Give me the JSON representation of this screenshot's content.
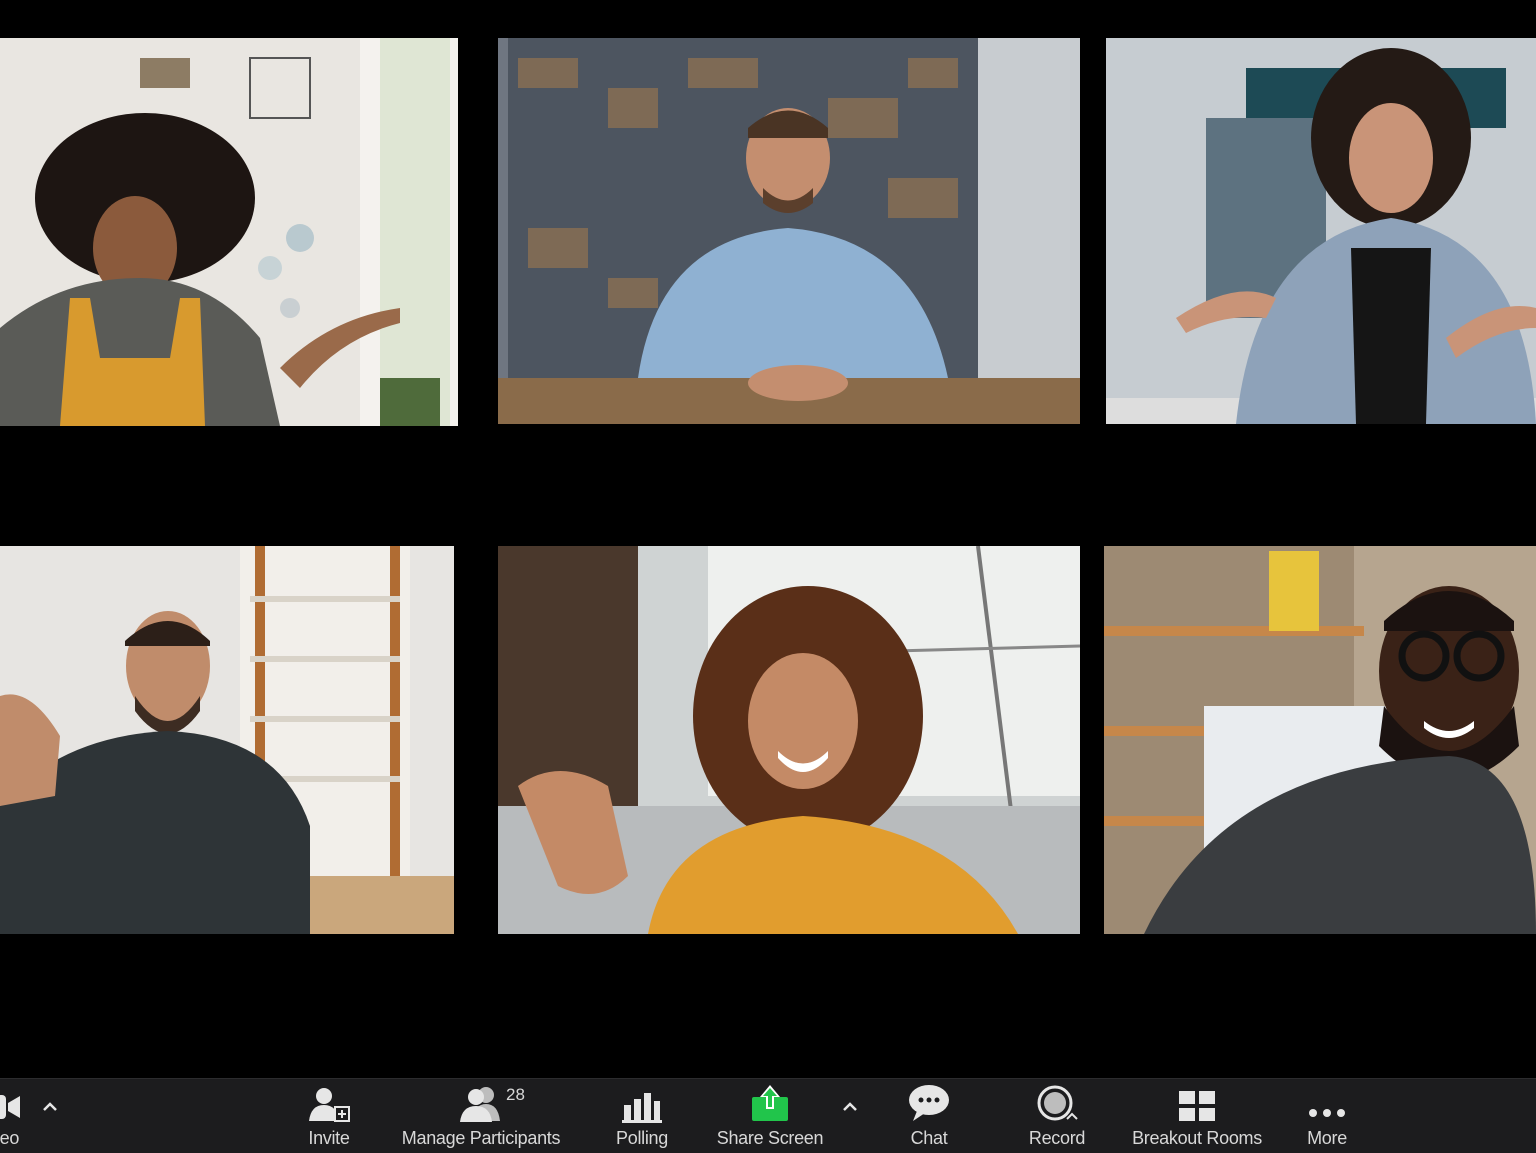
{
  "toolbar": {
    "video_label": "Video",
    "invite_label": "Invite",
    "participants_label": "Manage Participants",
    "participants_count": "28",
    "polling_label": "Polling",
    "share_label": "Share Screen",
    "chat_label": "Chat",
    "record_label": "Record",
    "breakout_label": "Breakout Rooms",
    "more_label": "More"
  },
  "icons": {
    "video": "video-camera-icon",
    "invite": "add-person-icon",
    "participants": "people-icon",
    "polling": "bar-chart-icon",
    "share": "share-arrow-icon",
    "chat": "speech-bubble-icon",
    "record": "record-icon",
    "breakout": "grid-icon",
    "more": "ellipsis-icon"
  },
  "colors": {
    "toolbar_bg": "#1c1c1e",
    "share_green": "#21c54b",
    "label": "#d8d8d8",
    "icon": "#e6e6e6"
  }
}
